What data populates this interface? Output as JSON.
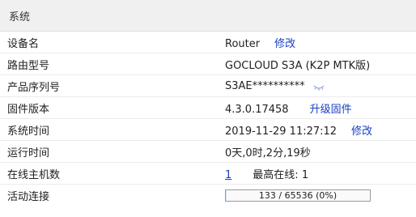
{
  "panel": {
    "title": "系统"
  },
  "rows": {
    "device_name": {
      "label": "设备名",
      "value": "Router",
      "action": "修改"
    },
    "model": {
      "label": "路由型号",
      "value": "GOCLOUD S3A (K2P MTK版)"
    },
    "serial": {
      "label": "产品序列号",
      "value": "S3AE**********"
    },
    "firmware": {
      "label": "固件版本",
      "value": "4.3.0.17458",
      "action": "升级固件"
    },
    "system_time": {
      "label": "系统时间",
      "value": "2019-11-29 11:27:12",
      "action": "修改"
    },
    "uptime": {
      "label": "运行时间",
      "value": "0天,0时,2分,19秒"
    },
    "online_hosts": {
      "label": "在线主机数",
      "value": "1",
      "max_label": "最高在线:",
      "max_value": "1"
    },
    "connections": {
      "label": "活动连接",
      "text": "133 / 65536 (0%)",
      "fraction": 0.002
    }
  },
  "icons": {
    "reveal": "eye-icon"
  },
  "colors": {
    "link": "#1a3fbf",
    "header_bg": "#f0f0f0"
  }
}
